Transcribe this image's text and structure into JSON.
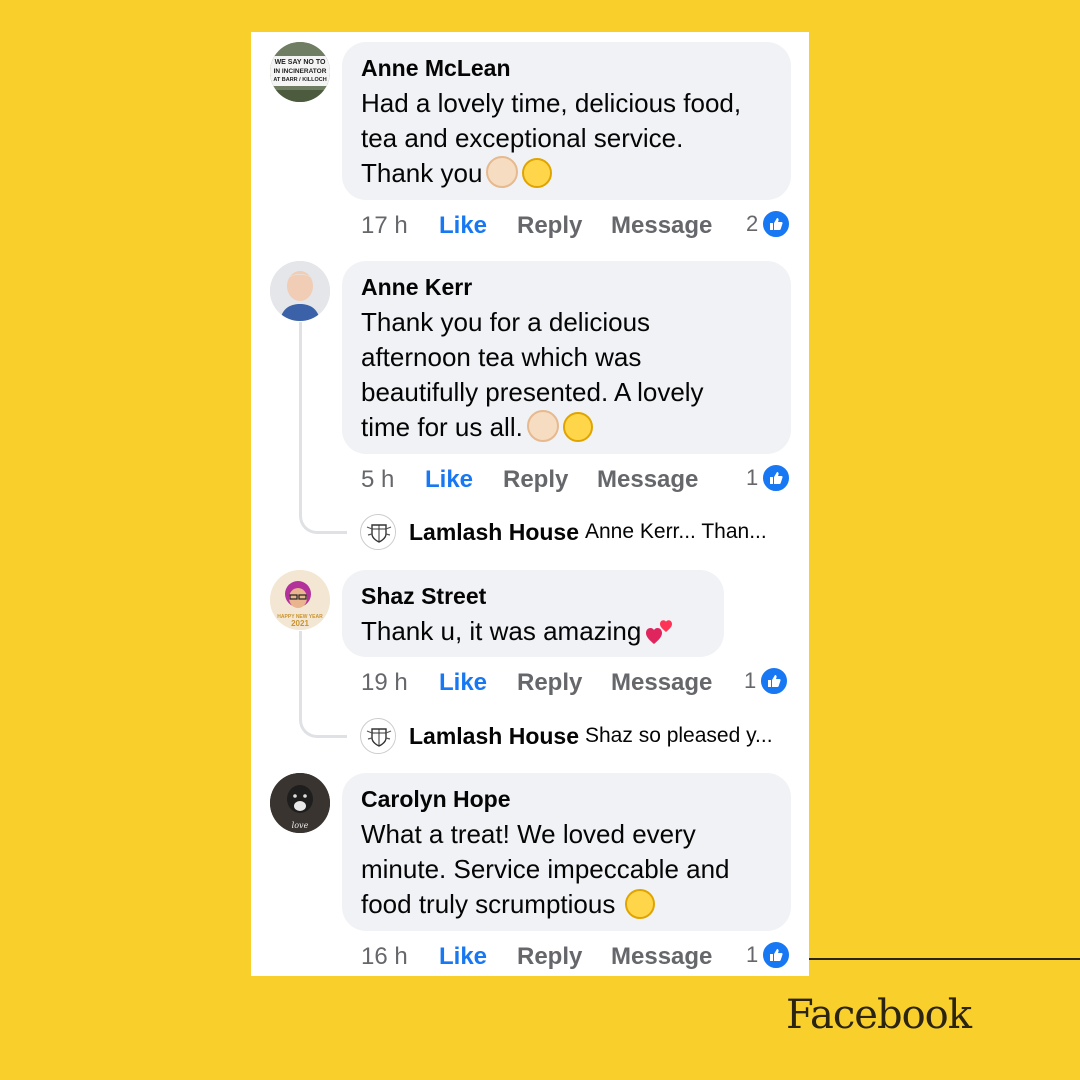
{
  "footer": {
    "brand": "Facebook"
  },
  "colors": {
    "background": "#f9cf2b",
    "like_blue": "#1877f2",
    "bubble": "#f0f2f5"
  },
  "comments": [
    {
      "author": "Anne McLean",
      "text": "Had a lovely time, delicious food,\ntea and exceptional service.\nThank you",
      "emojis": [
        "clapping-hands",
        "grinning-face"
      ],
      "avatar_text": [
        "WE SAY NO TO",
        "IN INCINERATOR",
        "AT BARR / KILLOCH"
      ],
      "time": "17 h",
      "like": "Like",
      "reply": "Reply",
      "message": "Message",
      "reactions": "2"
    },
    {
      "author": "Anne Kerr",
      "text": "Thank you for a delicious\nafternoon tea which was\nbeautifully presented. A lovely\ntime for us all.",
      "emojis": [
        "clapping-hands",
        "smiling-face"
      ],
      "time": "5 h",
      "like": "Like",
      "reply": "Reply",
      "message": "Message",
      "reactions": "1",
      "reply_preview": {
        "author": "Lamlash House",
        "text": "Anne Kerr... Than..."
      }
    },
    {
      "author": "Shaz Street",
      "text": "Thank u, it was amazing",
      "emojis": [
        "two-hearts"
      ],
      "avatar_text": [
        "HAPPY NEW YEAR",
        "2021"
      ],
      "time": "19 h",
      "like": "Like",
      "reply": "Reply",
      "message": "Message",
      "reactions": "1",
      "reply_preview": {
        "author": "Lamlash House",
        "text": "Shaz so pleased y..."
      }
    },
    {
      "author": "Carolyn Hope",
      "text": "What a treat! We loved every\nminute. Service impeccable and\nfood truly scrumptious",
      "emojis": [
        "smiling-face"
      ],
      "avatar_text": [
        "love"
      ],
      "time": "16 h",
      "like": "Like",
      "reply": "Reply",
      "message": "Message",
      "reactions": "1"
    }
  ]
}
